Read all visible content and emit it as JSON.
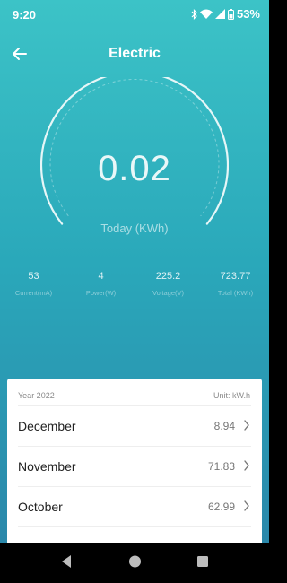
{
  "status_bar": {
    "time": "9:20",
    "battery": "53%",
    "icons": [
      "bluetooth-icon",
      "wifi-icon",
      "signal-icon",
      "battery-icon"
    ]
  },
  "header": {
    "title": "Electric",
    "back_icon": "arrow-left-icon"
  },
  "gauge": {
    "value": "0.02",
    "label": "Today (KWh)"
  },
  "stats": [
    {
      "value": "53",
      "label": "Current(mA)"
    },
    {
      "value": "4",
      "label": "Power(W)"
    },
    {
      "value": "225.2",
      "label": "Voltage(V)"
    },
    {
      "value": "723.77",
      "label": "Total (KWh)"
    }
  ],
  "history": {
    "year_label": "Year 2022",
    "unit_label": "Unit: kW.h",
    "months": [
      {
        "name": "December",
        "value": "8.94"
      },
      {
        "name": "November",
        "value": "71.83"
      },
      {
        "name": "October",
        "value": "62.99"
      }
    ]
  },
  "colors": {
    "gradient_top": "#3cc3c7",
    "gradient_bottom": "#2a83a8",
    "card": "#ffffff",
    "nav_bar": "#000000"
  }
}
